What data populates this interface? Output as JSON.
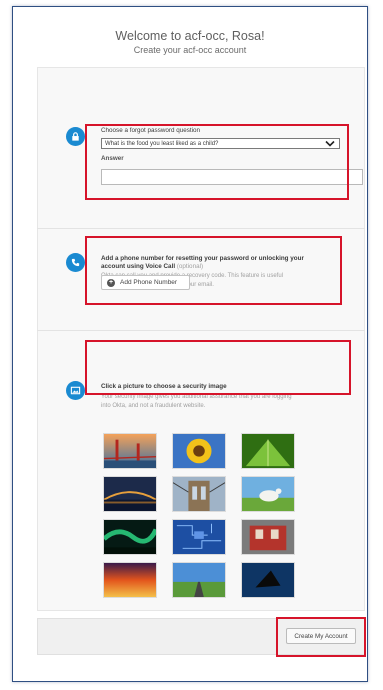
{
  "header": {
    "title": "Welcome to acf-occ, Rosa!",
    "subtitle": "Create your acf-occ account"
  },
  "password_section": {
    "icon": "lock-icon",
    "question_label": "Choose a forgot password question",
    "question_selected": "What is the food you least liked as a child?",
    "answer_label": "Answer",
    "answer_value": ""
  },
  "phone_section": {
    "icon": "phone-icon",
    "heading_line1": "Add a phone number for resetting your password or unlocking your",
    "heading_line2": "account using Voice Call",
    "optional_tag": "(optional)",
    "desc_line1": "Okta can call you and provide a recovery code. This feature is useful",
    "desc_line2": "when you don't have access to your email.",
    "button_label": "Add Phone Number"
  },
  "image_section": {
    "icon": "image-icon",
    "heading": "Click a picture to choose a security image",
    "desc_line1": "Your security image gives you additional assurance that you are logging",
    "desc_line2": "into Okta, and not a fraudulent website.",
    "images": [
      {
        "name": "golden-gate-bridge"
      },
      {
        "name": "sunflower"
      },
      {
        "name": "green-leaf"
      },
      {
        "name": "bridge-at-night"
      },
      {
        "name": "brooklyn-bridge"
      },
      {
        "name": "goat-on-grass"
      },
      {
        "name": "aurora-borealis"
      },
      {
        "name": "circuit-board"
      },
      {
        "name": "red-building"
      },
      {
        "name": "sunset-clouds"
      },
      {
        "name": "open-road"
      },
      {
        "name": "dark-leaf"
      }
    ]
  },
  "footer": {
    "create_button": "Create My Account"
  },
  "colors": {
    "accent_blue": "#1a8ad1",
    "highlight_red": "#d6142a"
  }
}
